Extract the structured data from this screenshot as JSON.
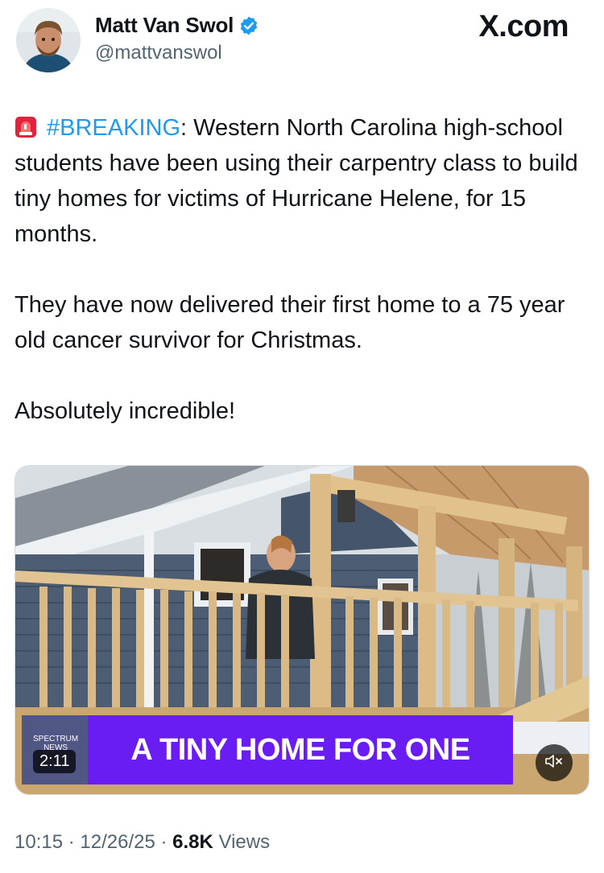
{
  "header": {
    "display_name": "Matt Van Swol",
    "handle": "@mattvanswol",
    "brand": "X.com",
    "verified_color": "#1d9bf0"
  },
  "tweet": {
    "hashtag": "#BREAKING",
    "line1_rest": ": Western North Carolina high-school students have been using their carpentry class to build tiny homes for victims of Hurricane Helene, for 15 months.",
    "paragraph2": "They have now delivered their first home to a 75 year old cancer survivor for Christmas.",
    "paragraph3": "Absolutely incredible!",
    "emoji_icon": "rotating-light-icon"
  },
  "media": {
    "caption": "A TINY HOME FOR ONE",
    "network_line1": "SPECTRUM",
    "network_line2": "NEWS",
    "duration": "2:11",
    "caption_color": "#6a1df2"
  },
  "meta": {
    "time": "10:15",
    "sep1": " · ",
    "date": "12/26/25",
    "sep2": " · ",
    "views_count": "6.8K",
    "views_label": " Views"
  }
}
